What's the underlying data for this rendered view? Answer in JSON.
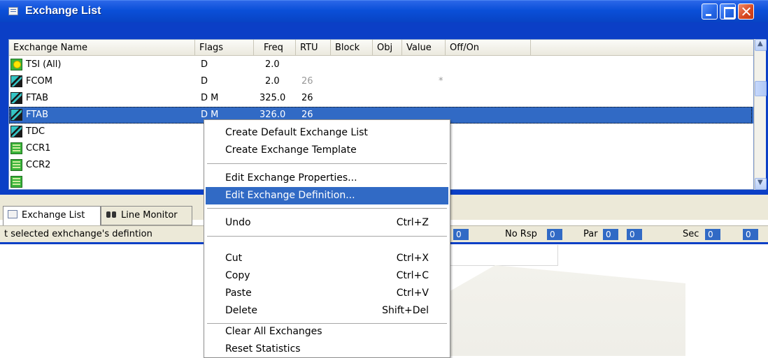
{
  "window": {
    "title": "Exchange List",
    "buttons": [
      "minimize",
      "maximize",
      "close"
    ]
  },
  "list": {
    "columns": [
      "Exchange Name",
      "Flags",
      "Freq",
      "RTU",
      "Block",
      "Obj",
      "Value",
      "Off/On"
    ],
    "rows": [
      {
        "name": "TSI (All)",
        "flags": "D",
        "freq": "2.0",
        "rtu": "",
        "value": "",
        "icon": "tsi-icon"
      },
      {
        "name": "FCOM",
        "flags": "D",
        "freq": "2.0",
        "rtu": "26",
        "value": "*",
        "icon": "exchange-icon"
      },
      {
        "name": "FTAB",
        "flags": "D  M",
        "freq": "325.0",
        "rtu": "26",
        "value": "",
        "icon": "exchange-icon"
      },
      {
        "name": "FTAB",
        "flags": "D  M",
        "freq": "326.0",
        "rtu": "26",
        "value": "",
        "icon": "exchange-icon"
      },
      {
        "name": "TDC",
        "flags": "",
        "freq": "",
        "rtu": "",
        "value": "",
        "icon": "exchange-icon"
      },
      {
        "name": "CCR1",
        "flags": "",
        "freq": "",
        "rtu": "",
        "value": "",
        "icon": "ccr-icon"
      },
      {
        "name": "CCR2",
        "flags": "",
        "freq": "",
        "rtu": "",
        "value": "",
        "icon": "ccr-icon"
      },
      {
        "name": "",
        "flags": "",
        "freq": "",
        "rtu": "",
        "value": "",
        "icon": "ccr-icon"
      }
    ]
  },
  "tabs": {
    "exchange_list": "Exchange List",
    "line_monitor": "Line Monitor"
  },
  "status": {
    "text": "t selected exhchange's defintion",
    "no_rsp_label": "No Rsp",
    "par_label": "Par",
    "sec_label": "Sec",
    "values": [
      "0",
      "0",
      "0",
      "0",
      "0",
      "0"
    ]
  },
  "context_menu": {
    "items": [
      {
        "label": "Create Default Exchange List",
        "shortcut": ""
      },
      {
        "label": "Create Exchange Template",
        "shortcut": ""
      },
      {
        "label": "Edit Exchange Properties...",
        "shortcut": ""
      },
      {
        "label": "Edit Exchange Definition...",
        "shortcut": ""
      },
      {
        "label": "Undo",
        "shortcut": "Ctrl+Z"
      },
      {
        "label": "Cut",
        "shortcut": "Ctrl+X"
      },
      {
        "label": "Copy",
        "shortcut": "Ctrl+C"
      },
      {
        "label": "Paste",
        "shortcut": "Ctrl+V"
      },
      {
        "label": "Delete",
        "shortcut": "Shift+Del"
      },
      {
        "label": "Clear All Exchanges",
        "shortcut": ""
      },
      {
        "label": "Reset Statistics",
        "shortcut": ""
      }
    ],
    "highlighted": "Edit Exchange Definition..."
  },
  "colors": {
    "titlebar": "#0a4fd8",
    "selection": "#316ac5",
    "frame": "#0b3fc6",
    "status_bg": "#ece9d8"
  }
}
